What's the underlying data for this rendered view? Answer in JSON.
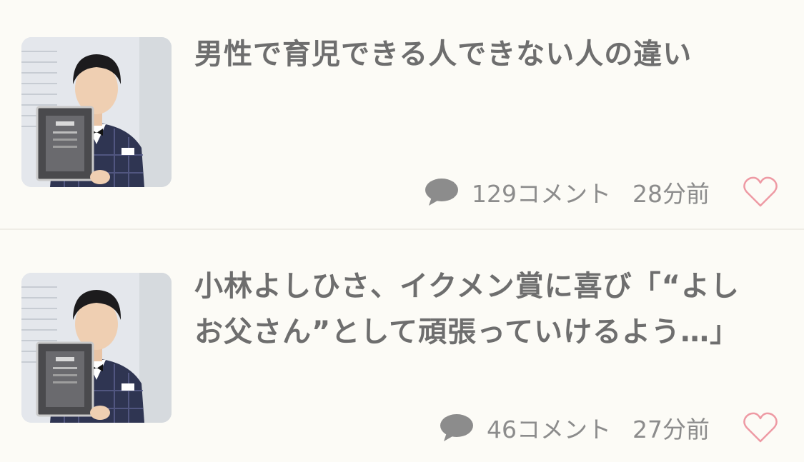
{
  "articles": [
    {
      "title": "男性で育児できる人できない人の違い",
      "comments": "129コメント",
      "time": "28分前",
      "thumbnail_icon": "article-thumbnail-photo",
      "like_icon": "heart-outline-icon"
    },
    {
      "title": "小林よしひさ、イクメン賞に喜び「“よしお父さん”として頑張っていけるよう…」",
      "comments": "46コメント",
      "time": "27分前",
      "thumbnail_icon": "article-thumbnail-photo",
      "like_icon": "heart-outline-icon"
    }
  ],
  "colors": {
    "background": "#fcfbf6",
    "title_text": "#6e6e6e",
    "meta_text": "#8c8c8c",
    "comment_icon": "#8c8c8c",
    "heart_icon": "#ee9aa4",
    "divider": "#efede6"
  }
}
